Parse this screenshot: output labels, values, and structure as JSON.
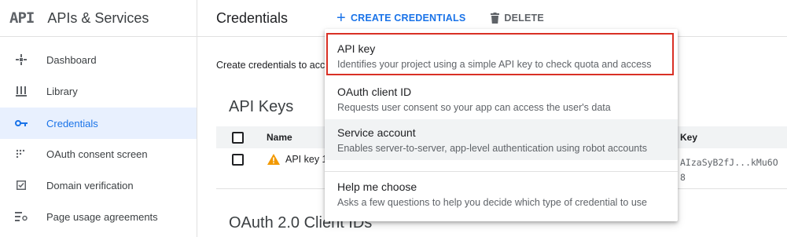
{
  "app": {
    "logo": "API",
    "title": "APIs & Services"
  },
  "sidebar": {
    "items": [
      {
        "label": "Dashboard",
        "icon": "dashboard-icon"
      },
      {
        "label": "Library",
        "icon": "library-icon"
      },
      {
        "label": "Credentials",
        "icon": "key-icon",
        "active": true
      },
      {
        "label": "OAuth consent screen",
        "icon": "consent-icon"
      },
      {
        "label": "Domain verification",
        "icon": "checkbox-icon"
      },
      {
        "label": "Page usage agreements",
        "icon": "settings-list-icon"
      }
    ]
  },
  "header": {
    "title": "Credentials",
    "create_label": "CREATE CREDENTIALS",
    "delete_label": "DELETE"
  },
  "main": {
    "description": "Create credentials to acc",
    "api_keys_title": "API Keys",
    "table": {
      "columns": {
        "name": "Name",
        "key": "Key"
      },
      "rows": [
        {
          "name": "API key 1",
          "key_line1": "AIzaSyB2fJ...kMu6O",
          "key_line2": "8"
        }
      ]
    },
    "oauth_title": "OAuth 2.0 Client IDs"
  },
  "menu": {
    "items": [
      {
        "title": "API key",
        "desc": "Identifies your project using a simple API key to check quota and access"
      },
      {
        "title": "OAuth client ID",
        "desc": "Requests user consent so your app can access the user's data"
      },
      {
        "title": "Service account",
        "desc": "Enables server-to-server, app-level authentication using robot accounts"
      },
      {
        "title": "Help me choose",
        "desc": "Asks a few questions to help you decide which type of credential to use"
      }
    ]
  },
  "colors": {
    "accent": "#1a73e8",
    "highlight_border": "#d93025",
    "warning": "#f29900"
  }
}
